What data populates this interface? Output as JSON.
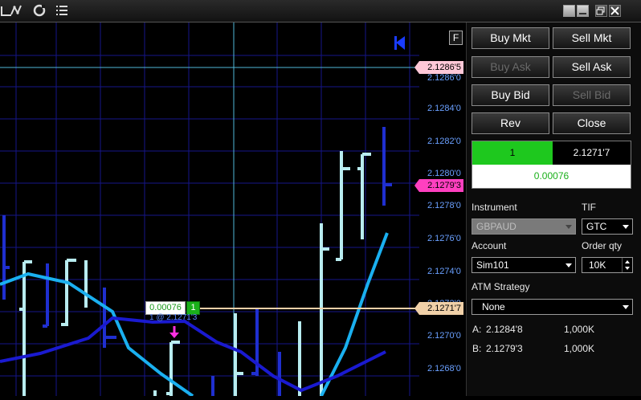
{
  "toolbar": {
    "icons": [
      "crosshair-icon",
      "drawing-tools-icon",
      "properties-icon",
      "reload-icon",
      "list-icon"
    ],
    "window_buttons": [
      "restore-icon",
      "minimize-icon",
      "maximize-icon",
      "close-icon"
    ]
  },
  "chart": {
    "grid_color": "#1a1a8c",
    "price_labels": [
      "2.1286'0",
      "2.1284'0",
      "2.1282'0",
      "2.1280'0",
      "2.1278'0",
      "2.1276'0",
      "2.1274'0",
      "2.1272'0",
      "2.1270'0",
      "2.1268'0"
    ],
    "ask_tag": "2.1286'5",
    "bid_tag": "2.1279'3",
    "position_tag": "2.1271'7",
    "position_pnl": "0.00076",
    "position_qty": "1",
    "position_sub": "1 @ 2.1271'3",
    "button_f": "F",
    "colors": {
      "bar_light": "#b8ecf0",
      "bar_dark": "#1f2fd0",
      "ma_light": "#1ab0f0",
      "ma_dark": "#1a1ad0",
      "ask": "#ffc8d8",
      "bid": "#ff40c0",
      "position": "#f0d0a8"
    }
  },
  "order_entry": {
    "buy_mkt": "Buy Mkt",
    "sell_mkt": "Sell Mkt",
    "buy_ask": "Buy Ask",
    "sell_ask": "Sell Ask",
    "buy_bid": "Buy Bid",
    "sell_bid": "Sell Bid",
    "rev": "Rev",
    "close": "Close",
    "position_qty": "1",
    "position_price": "2.1271'7",
    "pnl": "0.00076",
    "instrument_label": "Instrument",
    "instrument_value": "GBPAUD",
    "tif_label": "TIF",
    "tif_value": "GTC",
    "account_label": "Account",
    "account_value": "Sim101",
    "order_qty_label": "Order qty",
    "order_qty_value": "10K",
    "atm_label": "ATM Strategy",
    "atm_value": "None",
    "ask_label": "A:",
    "ask_price": "2.1284'8",
    "ask_size": "1,000K",
    "bid_label": "B:",
    "bid_price": "2.1279'3",
    "bid_size": "1,000K"
  }
}
